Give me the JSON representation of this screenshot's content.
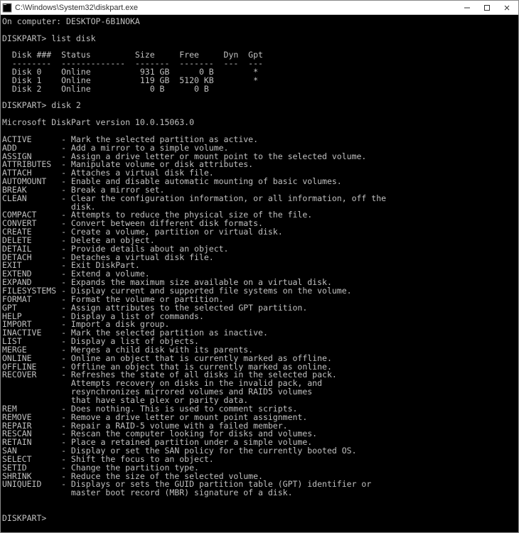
{
  "window": {
    "title_path": "C:\\Windows\\System32\\diskpart.exe"
  },
  "content": {
    "computer_line": "On computer: DESKTOP-6B1NOKA",
    "prompt1_label": "DISKPART>",
    "prompt1_cmd": "list disk",
    "disk_header": "  Disk ###  Status         Size     Free     Dyn  Gpt",
    "disk_sep": "  --------  -------------  -------  -------  ---  ---",
    "disk_rows": [
      "  Disk 0    Online          931 GB      0 B        *",
      "  Disk 1    Online          119 GB  5120 KB        *",
      "  Disk 2    Online            0 B      0 B"
    ],
    "prompt2_label": "DISKPART>",
    "prompt2_cmd": "disk 2",
    "version_line": "Microsoft DiskPart version 10.0.15063.0",
    "commands": [
      [
        "ACTIVE",
        "- Mark the selected partition as active."
      ],
      [
        "ADD",
        "- Add a mirror to a simple volume."
      ],
      [
        "ASSIGN",
        "- Assign a drive letter or mount point to the selected volume."
      ],
      [
        "ATTRIBUTES",
        "- Manipulate volume or disk attributes."
      ],
      [
        "ATTACH",
        "- Attaches a virtual disk file."
      ],
      [
        "AUTOMOUNT",
        "- Enable and disable automatic mounting of basic volumes."
      ],
      [
        "BREAK",
        "- Break a mirror set."
      ],
      [
        "CLEAN",
        "- Clear the configuration information, or all information, off the"
      ],
      [
        "",
        "  disk."
      ],
      [
        "COMPACT",
        "- Attempts to reduce the physical size of the file."
      ],
      [
        "CONVERT",
        "- Convert between different disk formats."
      ],
      [
        "CREATE",
        "- Create a volume, partition or virtual disk."
      ],
      [
        "DELETE",
        "- Delete an object."
      ],
      [
        "DETAIL",
        "- Provide details about an object."
      ],
      [
        "DETACH",
        "- Detaches a virtual disk file."
      ],
      [
        "EXIT",
        "- Exit DiskPart."
      ],
      [
        "EXTEND",
        "- Extend a volume."
      ],
      [
        "EXPAND",
        "- Expands the maximum size available on a virtual disk."
      ],
      [
        "FILESYSTEMS",
        "- Display current and supported file systems on the volume."
      ],
      [
        "FORMAT",
        "- Format the volume or partition."
      ],
      [
        "GPT",
        "- Assign attributes to the selected GPT partition."
      ],
      [
        "HELP",
        "- Display a list of commands."
      ],
      [
        "IMPORT",
        "- Import a disk group."
      ],
      [
        "INACTIVE",
        "- Mark the selected partition as inactive."
      ],
      [
        "LIST",
        "- Display a list of objects."
      ],
      [
        "MERGE",
        "- Merges a child disk with its parents."
      ],
      [
        "ONLINE",
        "- Online an object that is currently marked as offline."
      ],
      [
        "OFFLINE",
        "- Offline an object that is currently marked as online."
      ],
      [
        "RECOVER",
        "- Refreshes the state of all disks in the selected pack."
      ],
      [
        "",
        "  Attempts recovery on disks in the invalid pack, and"
      ],
      [
        "",
        "  resynchronizes mirrored volumes and RAID5 volumes"
      ],
      [
        "",
        "  that have stale plex or parity data."
      ],
      [
        "REM",
        "- Does nothing. This is used to comment scripts."
      ],
      [
        "REMOVE",
        "- Remove a drive letter or mount point assignment."
      ],
      [
        "REPAIR",
        "- Repair a RAID-5 volume with a failed member."
      ],
      [
        "RESCAN",
        "- Rescan the computer looking for disks and volumes."
      ],
      [
        "RETAIN",
        "- Place a retained partition under a simple volume."
      ],
      [
        "SAN",
        "- Display or set the SAN policy for the currently booted OS."
      ],
      [
        "SELECT",
        "- Shift the focus to an object."
      ],
      [
        "SETID",
        "- Change the partition type."
      ],
      [
        "SHRINK",
        "- Reduce the size of the selected volume."
      ],
      [
        "UNIQUEID",
        "- Displays or sets the GUID partition table (GPT) identifier or"
      ],
      [
        "",
        "  master boot record (MBR) signature of a disk."
      ]
    ],
    "prompt3_label": "DISKPART>",
    "prompt3_cmd": ""
  }
}
